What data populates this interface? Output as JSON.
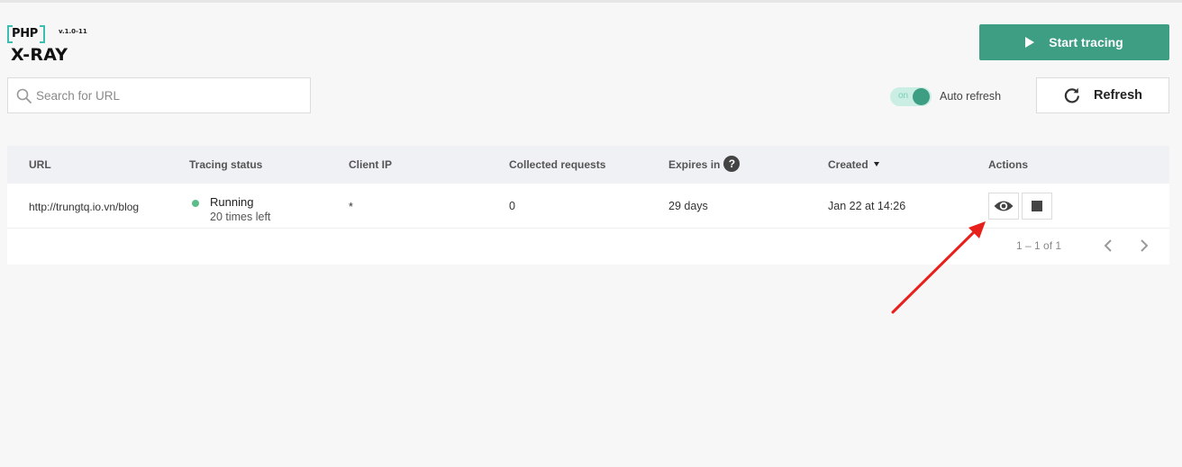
{
  "logo": {
    "php": "PHP",
    "version": "v.1.0-11",
    "name": "X-RAY"
  },
  "header": {
    "start_tracing_label": "Start tracing"
  },
  "search": {
    "placeholder": "Search for URL",
    "value": ""
  },
  "auto_refresh": {
    "state_label": "on",
    "label": "Auto refresh",
    "enabled": true
  },
  "refresh": {
    "label": "Refresh"
  },
  "table": {
    "columns": {
      "url": "URL",
      "status": "Tracing status",
      "client_ip": "Client IP",
      "collected": "Collected requests",
      "expires": "Expires in",
      "created": "Created",
      "actions": "Actions"
    },
    "help_glyph": "?",
    "rows": [
      {
        "url": "http://trungtq.io.vn/blog",
        "status": "Running",
        "status_sub": "20 times left",
        "client_ip": "*",
        "collected": "0",
        "expires": "29 days",
        "created": "Jan 22 at 14:26"
      }
    ],
    "pagination": "1 – 1 of 1"
  },
  "colors": {
    "accent": "#3d9e84",
    "logo_bracket": "#3cbfb0",
    "status_running": "#5cbd8a",
    "annotation_arrow": "#e8201c"
  },
  "icons": [
    "play-icon",
    "search-icon",
    "refresh-icon",
    "help-icon",
    "sort-down-icon",
    "eye-icon",
    "stop-icon",
    "chevron-left-icon",
    "chevron-right-icon",
    "annotation-arrow"
  ]
}
